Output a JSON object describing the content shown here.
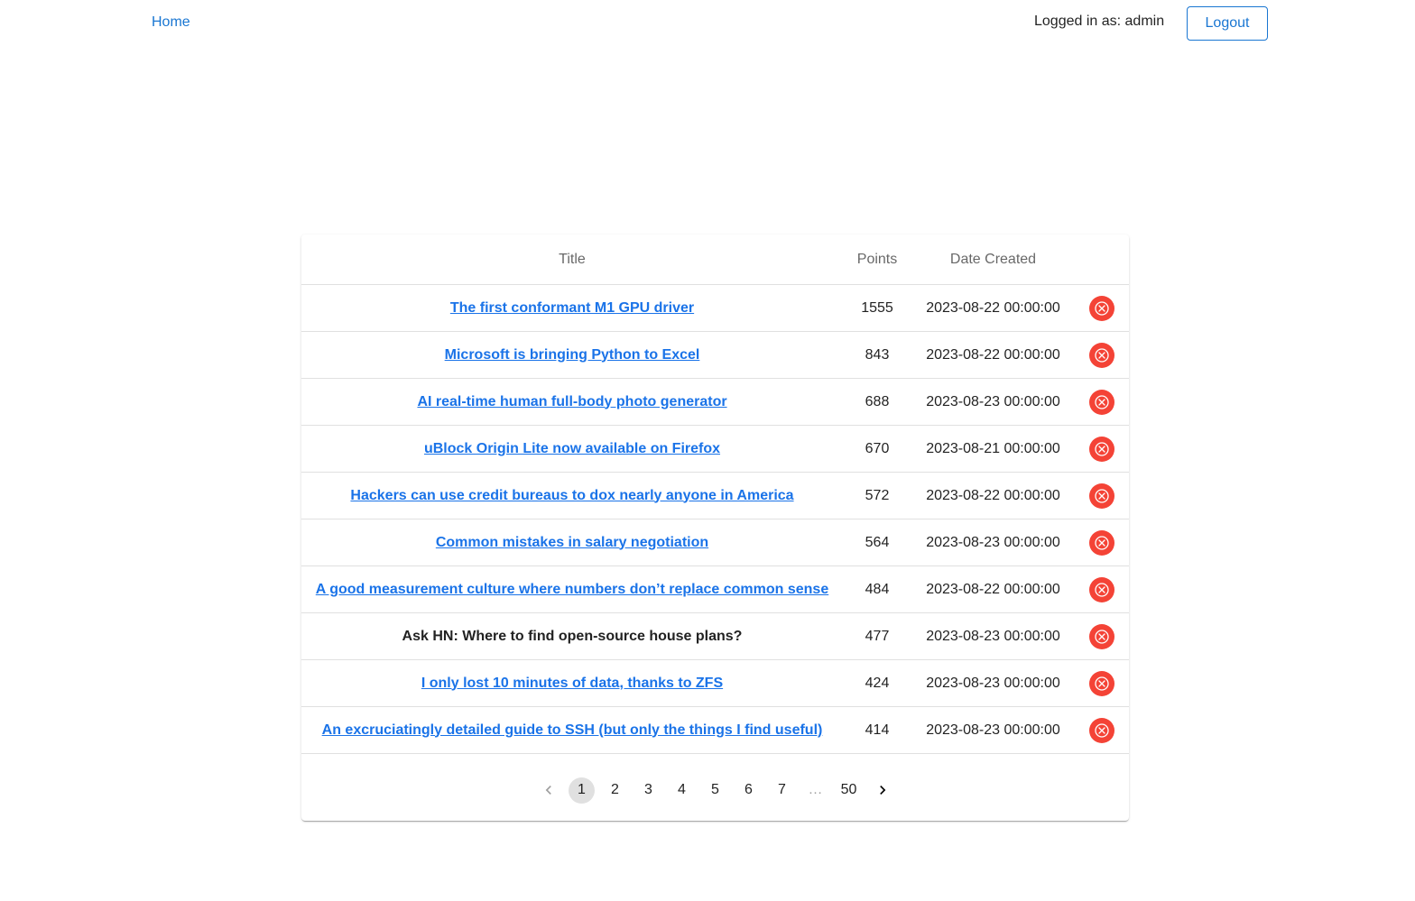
{
  "nav": {
    "home_label": "Home",
    "logged_in_text": "Logged in as: admin",
    "logout_label": "Logout"
  },
  "table": {
    "headers": {
      "title": "Title",
      "points": "Points",
      "date": "Date Created"
    },
    "rows": [
      {
        "title": "The first conformant M1 GPU driver",
        "points": "1555",
        "date": "2023-08-22 00:00:00",
        "is_link": true
      },
      {
        "title": "Microsoft is bringing Python to Excel",
        "points": "843",
        "date": "2023-08-22 00:00:00",
        "is_link": true
      },
      {
        "title": "AI real-time human full-body photo generator",
        "points": "688",
        "date": "2023-08-23 00:00:00",
        "is_link": true
      },
      {
        "title": "uBlock Origin Lite now available on Firefox",
        "points": "670",
        "date": "2023-08-21 00:00:00",
        "is_link": true
      },
      {
        "title": "Hackers can use credit bureaus to dox nearly anyone in America",
        "points": "572",
        "date": "2023-08-22 00:00:00",
        "is_link": true
      },
      {
        "title": "Common mistakes in salary negotiation",
        "points": "564",
        "date": "2023-08-23 00:00:00",
        "is_link": true
      },
      {
        "title": "A good measurement culture where numbers don’t replace common sense",
        "points": "484",
        "date": "2023-08-22 00:00:00",
        "is_link": true
      },
      {
        "title": "Ask HN: Where to find open-source house plans?",
        "points": "477",
        "date": "2023-08-23 00:00:00",
        "is_link": false
      },
      {
        "title": "I only lost 10 minutes of data, thanks to ZFS",
        "points": "424",
        "date": "2023-08-23 00:00:00",
        "is_link": true
      },
      {
        "title": "An excruciatingly detailed guide to SSH (but only the things I find useful)",
        "points": "414",
        "date": "2023-08-23 00:00:00",
        "is_link": true
      }
    ]
  },
  "pagination": {
    "pages": [
      "1",
      "2",
      "3",
      "4",
      "5",
      "6",
      "7"
    ],
    "ellipsis": "…",
    "last_page": "50",
    "current": "1",
    "prev_icon": "chevron-left-icon",
    "next_icon": "chevron-right-icon"
  },
  "colors": {
    "link": "#1a73e8",
    "primary": "#1976d2",
    "delete": "#f44336"
  }
}
